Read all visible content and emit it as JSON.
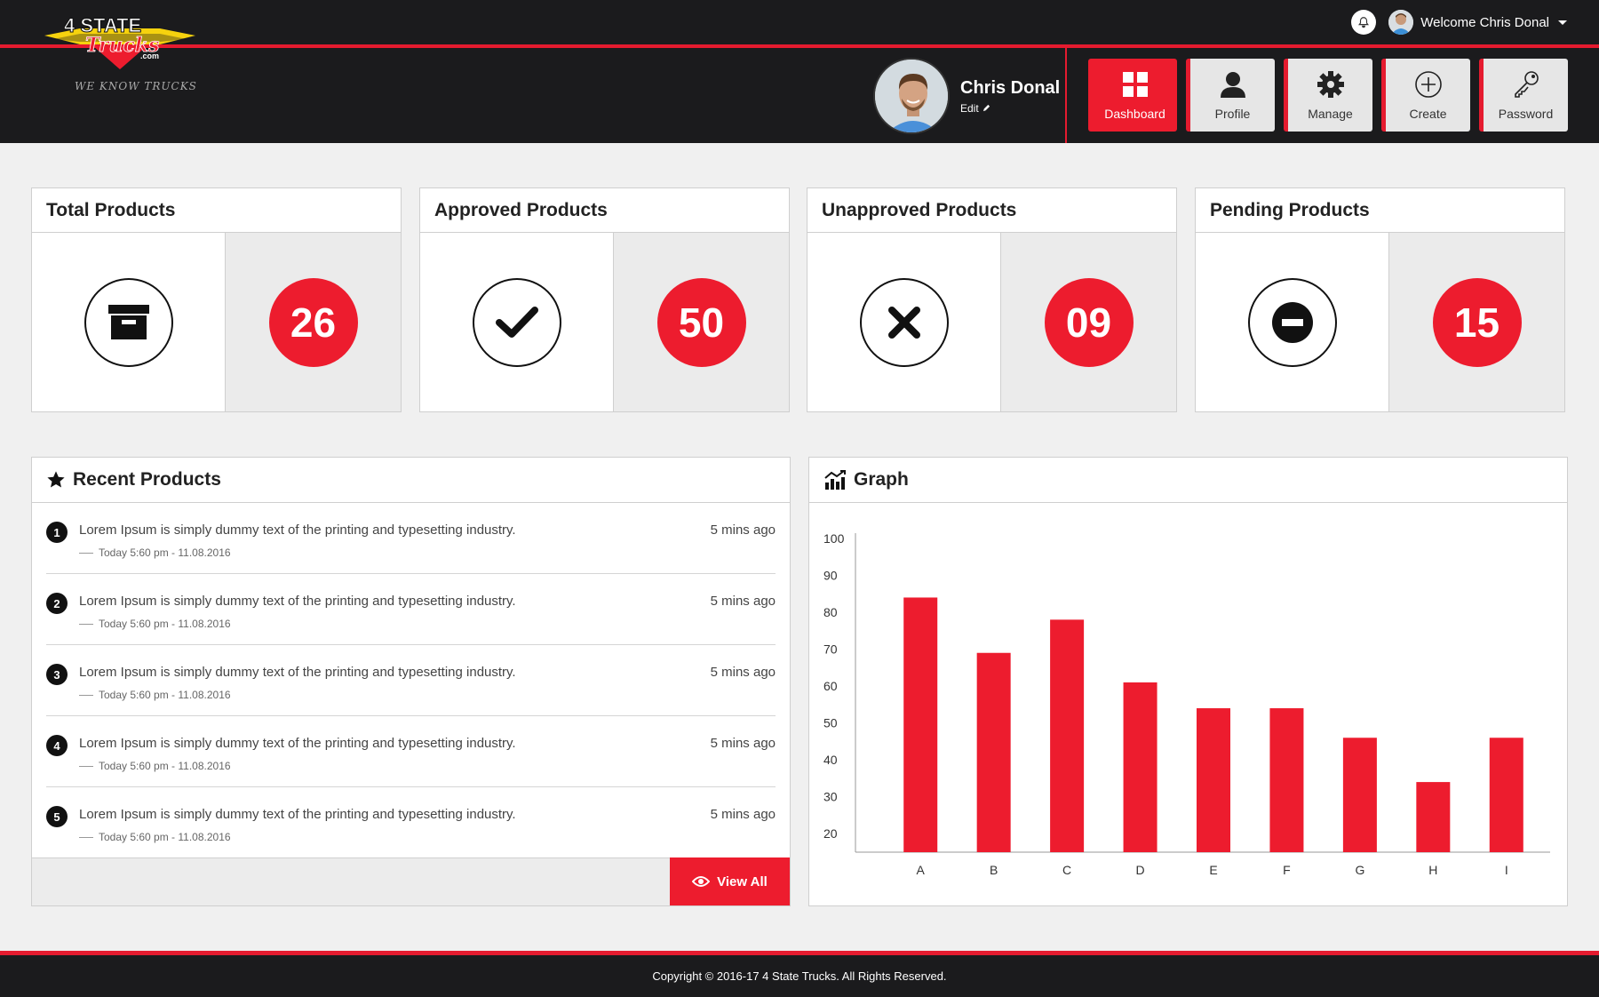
{
  "brand": {
    "logo_line1": "4 STATE",
    "logo_line2": "Trucks",
    "logo_domain": ".com",
    "tagline": "WE KNOW TRUCKS",
    "accent": "#ed1c2e",
    "dark": "#1b1b1d"
  },
  "topbar": {
    "welcome": "Welcome Chris Donal",
    "bell_icon": "bell-icon"
  },
  "user": {
    "name": "Chris Donal",
    "edit_label": "Edit"
  },
  "nav": {
    "dashboard": "Dashboard",
    "profile": "Profile",
    "manage": "Manage",
    "create": "Create",
    "password": "Password"
  },
  "stats": [
    {
      "title": "Total Products",
      "count": "26",
      "icon": "archive-icon"
    },
    {
      "title": "Approved Products",
      "count": "50",
      "icon": "check-icon"
    },
    {
      "title": "Unapproved Products",
      "count": "09",
      "icon": "x-icon"
    },
    {
      "title": "Pending Products",
      "count": "15",
      "icon": "minus-circle-icon"
    }
  ],
  "recent": {
    "title": "Recent Products",
    "items": [
      {
        "num": "1",
        "text": "Lorem Ipsum is simply dummy text of the printing and typesetting industry.",
        "time": "5 mins ago",
        "date": "Today 5:60 pm - 11.08.2016"
      },
      {
        "num": "2",
        "text": "Lorem Ipsum is simply dummy text of the printing and typesetting industry.",
        "time": "5 mins ago",
        "date": "Today 5:60 pm - 11.08.2016"
      },
      {
        "num": "3",
        "text": "Lorem Ipsum is simply dummy text of the printing and typesetting industry.",
        "time": "5 mins ago",
        "date": "Today 5:60 pm - 11.08.2016"
      },
      {
        "num": "4",
        "text": "Lorem Ipsum is simply dummy text of the printing and typesetting industry.",
        "time": "5 mins ago",
        "date": "Today 5:60 pm - 11.08.2016"
      },
      {
        "num": "5",
        "text": "Lorem Ipsum is simply dummy text of the printing and typesetting industry.",
        "time": "5 mins ago",
        "date": "Today 5:60 pm - 11.08.2016"
      }
    ],
    "view_all": "View All"
  },
  "graph": {
    "title": "Graph"
  },
  "chart_data": {
    "type": "bar",
    "categories": [
      "A",
      "B",
      "C",
      "D",
      "E",
      "F",
      "G",
      "H",
      "I"
    ],
    "values": [
      84,
      69,
      78,
      61,
      54,
      54,
      46,
      34,
      46
    ],
    "ylim": [
      15,
      100
    ],
    "yticks": [
      20,
      30,
      40,
      50,
      60,
      70,
      80,
      90,
      100
    ],
    "grid": false,
    "color": "#ed1c2e"
  },
  "footer": {
    "copyright": "Copyright © 2016-17 4 State Trucks. All Rights Reserved."
  }
}
